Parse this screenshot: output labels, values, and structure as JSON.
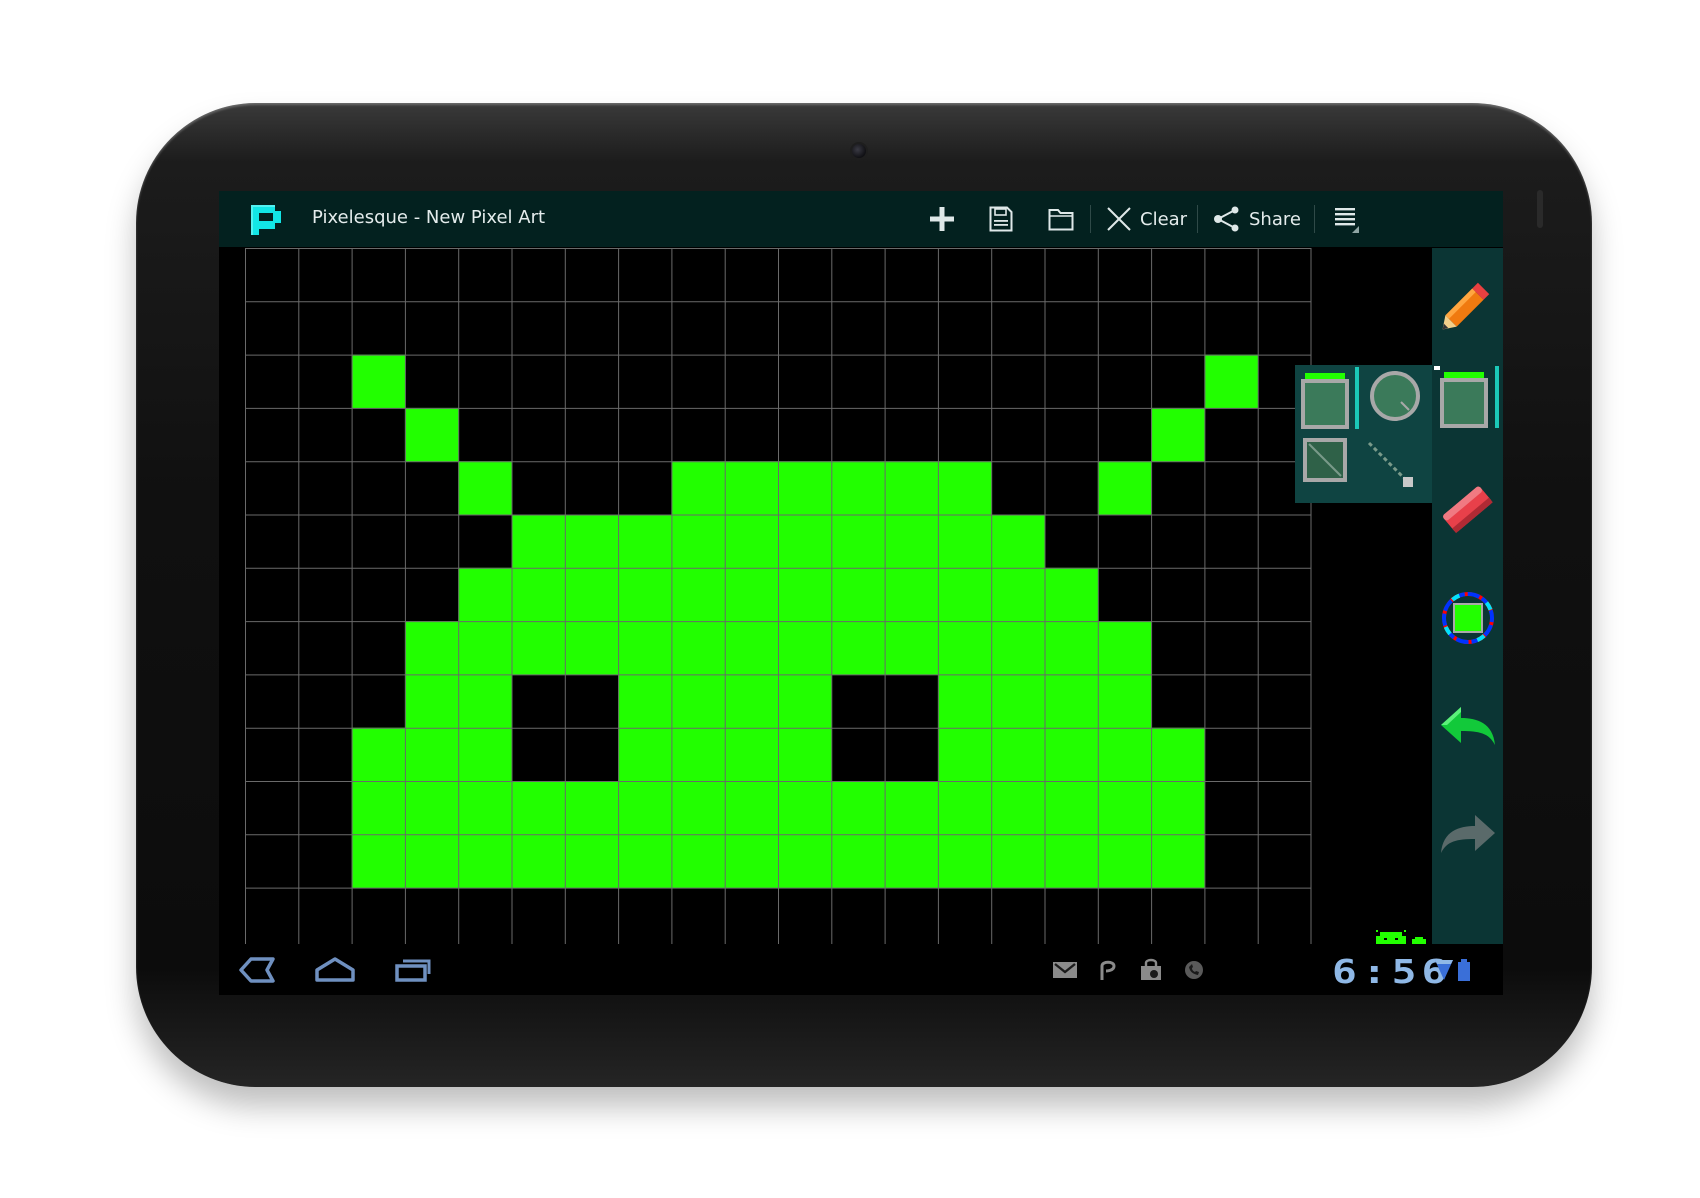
{
  "app": {
    "title": "Pixelesque - New Pixel Art",
    "logo_icon": "pixelesque-logo-icon"
  },
  "action_bar": {
    "new_icon": "plus-icon",
    "save_icon": "save-icon",
    "open_icon": "folder-icon",
    "clear": {
      "icon": "close-icon",
      "label": "Clear"
    },
    "share": {
      "icon": "share-icon",
      "label": "Share"
    },
    "menu_icon": "overflow-menu-icon"
  },
  "canvas": {
    "columns": 20,
    "rows": 12,
    "background_color": "#000000",
    "grid_color": "#6a6a6a",
    "paint_color": "#22ff00",
    "pixel_art": [
      "....................",
      "....................",
      "..#...............#.",
      "...#.............#..",
      "....#...######..#...",
      ".....##########.....",
      "....############....",
      "...##############...",
      "...##..####..####...",
      "..###..####..#####..",
      "..################..",
      "..################.."
    ]
  },
  "tools": [
    {
      "name": "pencil",
      "icon": "pencil-icon"
    },
    {
      "name": "shapes",
      "icon": "rectangle-shape-icon",
      "selected": true
    },
    {
      "name": "eraser",
      "icon": "eraser-icon"
    },
    {
      "name": "color",
      "icon": "color-picker-icon",
      "current_color": "#22ff00"
    },
    {
      "name": "undo",
      "icon": "undo-icon"
    },
    {
      "name": "redo",
      "icon": "redo-icon",
      "enabled": false
    }
  ],
  "shape_popup": {
    "items": [
      {
        "name": "filled-rectangle",
        "icon": "filled-rectangle-icon",
        "selected": true
      },
      {
        "name": "circle",
        "icon": "circle-icon"
      },
      {
        "name": "outline-rectangle",
        "icon": "outline-rectangle-icon"
      },
      {
        "name": "line",
        "icon": "line-icon"
      }
    ]
  },
  "system_bar": {
    "back_icon": "back-icon",
    "home_icon": "home-icon",
    "recent_apps_icon": "recent-apps-icon",
    "notifications": [
      "gmail-icon",
      "market-icon",
      "shopping-bag-icon",
      "phone-icon"
    ],
    "clock": "6:56",
    "wifi_icon": "wifi-icon",
    "battery_icon": "battery-icon"
  },
  "colors": {
    "action_bar": "#03211f",
    "tool_rail": "#0b3534",
    "accent": "#1bc9b8"
  }
}
